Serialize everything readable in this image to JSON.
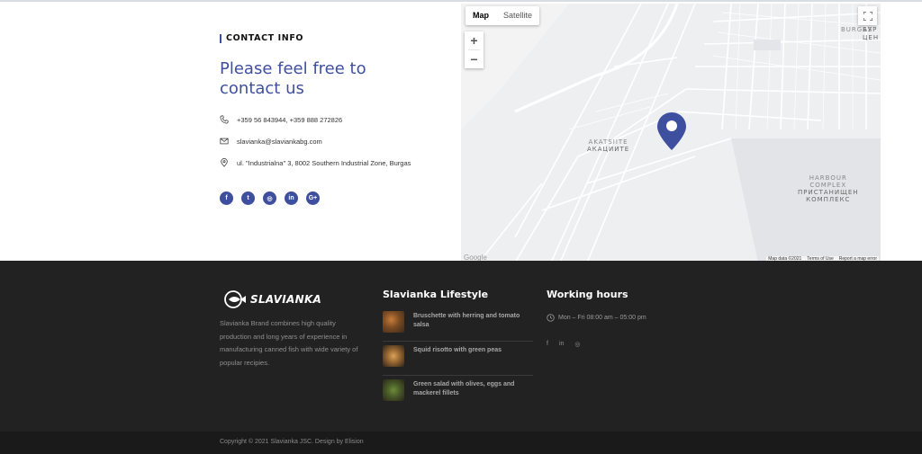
{
  "contact": {
    "section_label": "CONTACT INFO",
    "headline_line1": "Please feel free to",
    "headline_line2": "contact us",
    "phone": "+359 56 843944, +359 888 272826",
    "email": "slavianka@slaviankabg.com",
    "address": "ul. \"Industrialna\" 3, 8002 Southern Industrial Zone, Burgas",
    "socials": [
      {
        "icon": "facebook-icon",
        "glyph": "f"
      },
      {
        "icon": "twitter-icon",
        "glyph": "t"
      },
      {
        "icon": "instagram-icon",
        "glyph": "◎"
      },
      {
        "icon": "linkedin-icon",
        "glyph": "in"
      },
      {
        "icon": "google-plus-icon",
        "glyph": "G+"
      }
    ]
  },
  "map": {
    "tab_map": "Map",
    "tab_satellite": "Satellite",
    "zoom_in": "+",
    "zoom_out": "−",
    "label_burgas": "BURGAS",
    "label_burgas_cyr": "БУР\nЦЕН",
    "label_akatsiite": "AKATSIITE",
    "label_akatsiite_cyr": "АКАЦИИТЕ",
    "label_harbour": "HARBOUR\nCOMPLEX",
    "label_harbour_cyr": "ПРИСТАНИЩЕН\nКОМПЛЕКС",
    "footer_data": "Map data ©2021",
    "footer_terms": "Terms of Use",
    "footer_report": "Report a map error",
    "google": "Google",
    "pin_color": "#3f4fa0"
  },
  "footer": {
    "brand_name": "SLAVIANKA",
    "brand_desc": "Slavianka Brand combines high quality production and long years of experience in manufacturing canned fish with wide variety of popular recipies.",
    "lifestyle_title": "Slavianka Lifestyle",
    "posts": [
      {
        "title": "Bruschette with herring and tomato salsa"
      },
      {
        "title": "Squid risotto with green peas"
      },
      {
        "title": "Green salad with olives, eggs and mackerel fillets"
      }
    ],
    "hours_title": "Working hours",
    "hours_text": "Mon – Fri 08:00 am – 05:00 pm",
    "socials": [
      {
        "icon": "facebook-icon",
        "glyph": "f"
      },
      {
        "icon": "linkedin-icon",
        "glyph": "in"
      },
      {
        "icon": "instagram-icon",
        "glyph": "◎"
      }
    ],
    "copyright": "Copyright © 2021 Slavianka JSC. Design by Elision"
  },
  "colors": {
    "accent": "#3f4fa0",
    "footer_bg": "#222222",
    "bottom_bar_bg": "#1a1a1a"
  }
}
